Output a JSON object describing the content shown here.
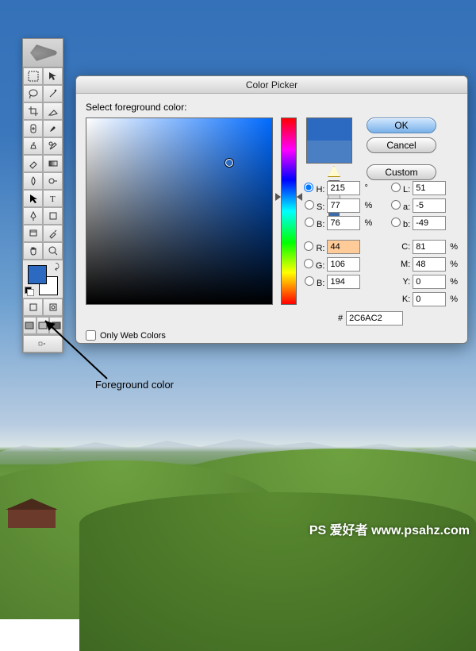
{
  "dialog": {
    "title": "Color Picker",
    "prompt": "Select foreground color:",
    "ok": "OK",
    "cancel": "Cancel",
    "custom": "Custom",
    "only_web": "Only Web Colors",
    "hex_label": "#",
    "hex": "2C6AC2",
    "H": {
      "label": "H:",
      "value": "215",
      "unit": "°"
    },
    "S": {
      "label": "S:",
      "value": "77",
      "unit": "%"
    },
    "Bv": {
      "label": "B:",
      "value": "76",
      "unit": "%"
    },
    "L": {
      "label": "L:",
      "value": "51"
    },
    "a": {
      "label": "a:",
      "value": "-5"
    },
    "b": {
      "label": "b:",
      "value": "-49"
    },
    "R": {
      "label": "R:",
      "value": "44"
    },
    "G": {
      "label": "G:",
      "value": "106"
    },
    "Bc": {
      "label": "B:",
      "value": "194"
    },
    "C": {
      "label": "C:",
      "value": "81",
      "unit": "%"
    },
    "M": {
      "label": "M:",
      "value": "48",
      "unit": "%"
    },
    "Y": {
      "label": "Y:",
      "value": "0",
      "unit": "%"
    },
    "K": {
      "label": "K:",
      "value": "0",
      "unit": "%"
    }
  },
  "annotation": "Foreground color",
  "watermark": "PS 爱好者 www.psahz.com",
  "colors": {
    "foreground": "#2C6AC2",
    "background": "#FFFFFF"
  }
}
